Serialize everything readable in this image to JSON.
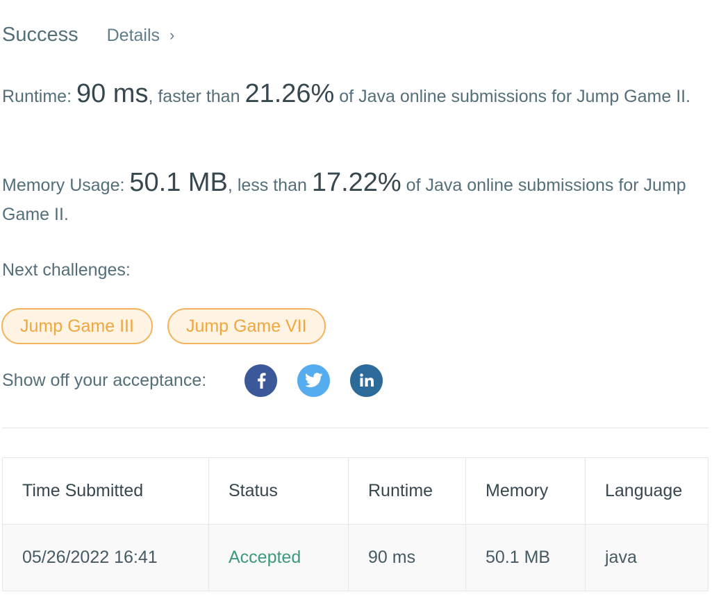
{
  "header": {
    "status": "Success",
    "details_label": "Details",
    "details_chevron": "›"
  },
  "runtime": {
    "label": "Runtime: ",
    "value": "90 ms",
    "comparison": ", faster than ",
    "percent": "21.26%",
    "suffix": " of Java online submissions for Jump Game II."
  },
  "memory": {
    "label": "Memory Usage: ",
    "value": "50.1 MB",
    "comparison": ", less than ",
    "percent": "17.22%",
    "suffix": " of Java online submissions for Jump Game II."
  },
  "next": {
    "label": "Next challenges:",
    "challenges": [
      "Jump Game III",
      "Jump Game VII"
    ]
  },
  "share": {
    "label": "Show off your acceptance:",
    "icons": [
      "facebook-icon",
      "twitter-icon",
      "linkedin-icon"
    ]
  },
  "table": {
    "headers": [
      "Time Submitted",
      "Status",
      "Runtime",
      "Memory",
      "Language"
    ],
    "rows": [
      [
        "05/26/2022 16:41",
        "Accepted",
        "90 ms",
        "50.1 MB",
        "java"
      ]
    ]
  },
  "colors": {
    "success": "#4caf93",
    "accepted": "#3d9a7f",
    "chip_border": "#f5b25b",
    "chip_bg": "#fff3e3",
    "chip_text": "#f0a73d",
    "facebook": "#3b5998",
    "twitter": "#55acee",
    "linkedin": "#2b6a99"
  }
}
